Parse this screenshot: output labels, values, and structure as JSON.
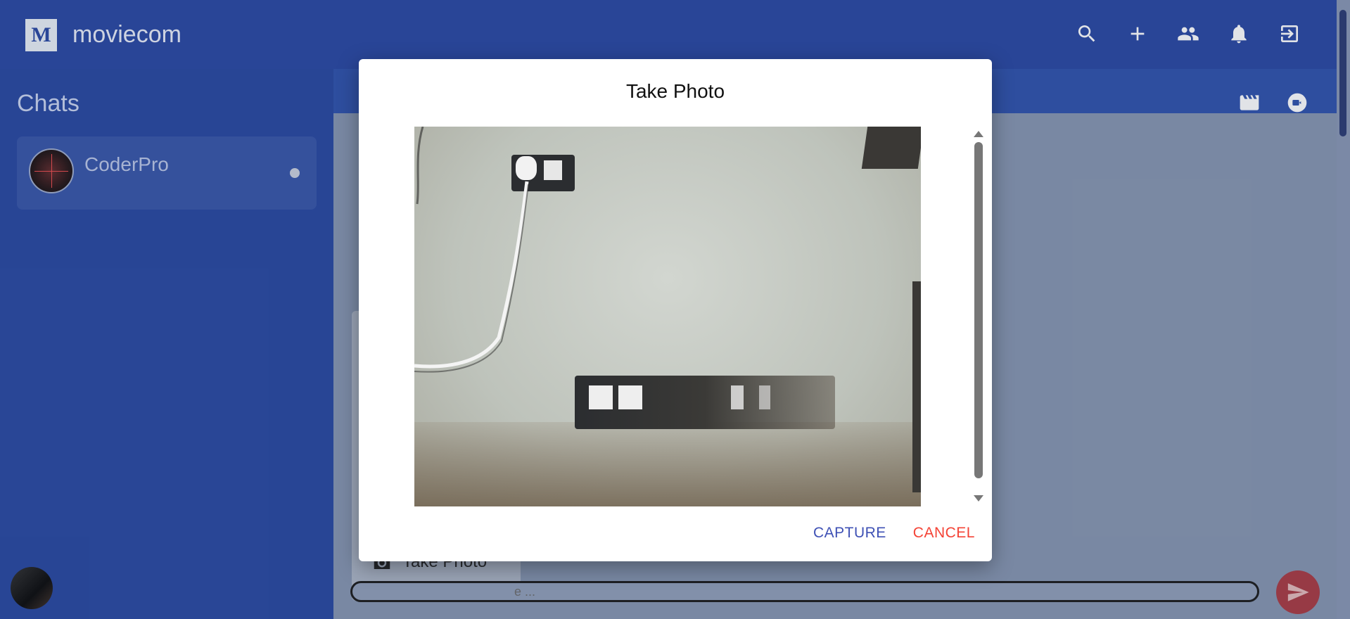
{
  "app": {
    "title": "moviecom",
    "logo_letter": "M"
  },
  "appbar": {
    "icons": [
      "search-icon",
      "add-icon",
      "people-icon",
      "notifications-icon",
      "logout-icon"
    ]
  },
  "sidebar": {
    "title": "Chats",
    "chats": [
      {
        "name": "CoderPro",
        "status": "online"
      }
    ]
  },
  "chat_header": {
    "icons": [
      "movie-icon",
      "video-call-icon"
    ]
  },
  "attach_menu": {
    "take_photo_label": "Take Photo"
  },
  "composer": {
    "placeholder_visible": "e ..."
  },
  "modal": {
    "title": "Take Photo",
    "capture_label": "CAPTURE",
    "cancel_label": "CANCEL"
  },
  "colors": {
    "primary": "#1f3f9e",
    "capture": "#3f51b5",
    "cancel": "#f44336",
    "send": "#a5313a"
  }
}
